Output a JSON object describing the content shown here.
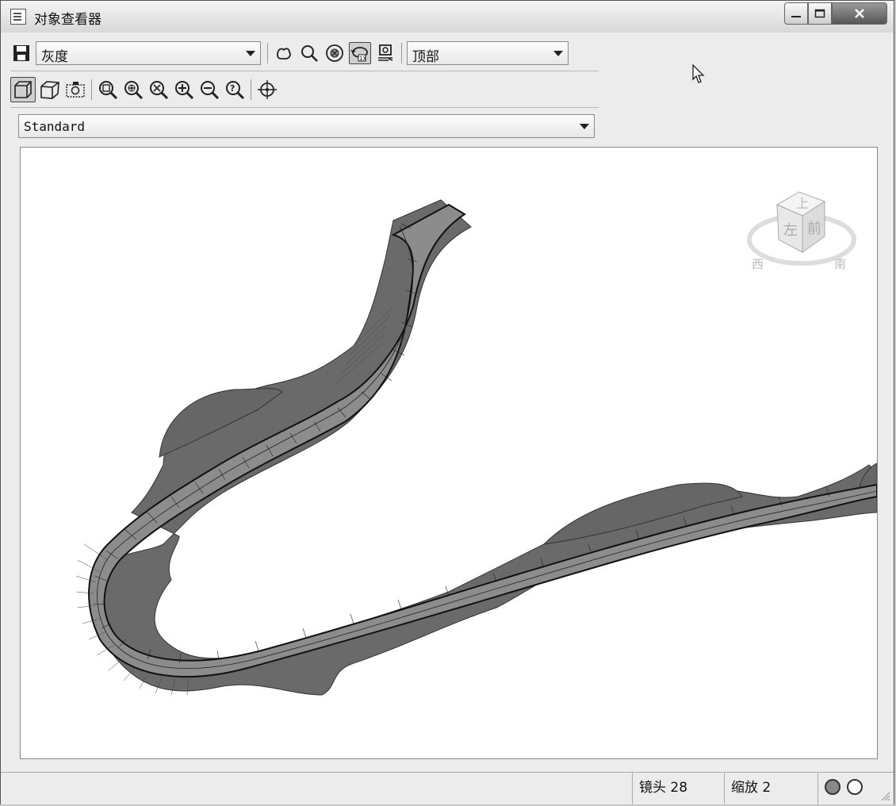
{
  "window": {
    "title": "对象查看器"
  },
  "toolbar": {
    "visual_style": "灰度",
    "view_direction": "顶部",
    "view_style": "Standard"
  },
  "viewcube": {
    "top_label": "上",
    "left_label": "左",
    "front_label": "前",
    "west_label": "西",
    "south_label": "南"
  },
  "status": {
    "camera": "镜头 28",
    "zoom": "缩放 2"
  }
}
